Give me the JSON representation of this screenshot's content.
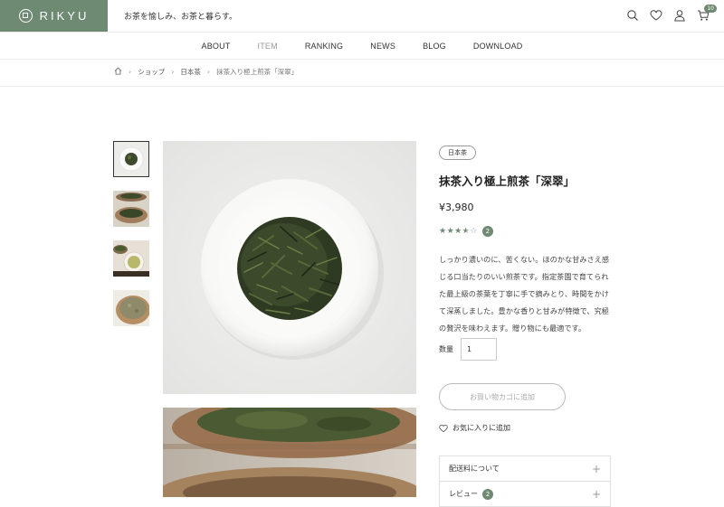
{
  "header": {
    "logo": "RIKYU",
    "tagline": "お茶を愉しみ、お茶と暮らす。",
    "icons": [
      "search-icon",
      "heart-icon",
      "user-icon",
      "cart-icon"
    ],
    "cart_count": "10"
  },
  "nav": {
    "items": [
      {
        "label": "ABOUT"
      },
      {
        "label": "ITEM"
      },
      {
        "label": "RANKING"
      },
      {
        "label": "NEWS"
      },
      {
        "label": "BLOG"
      },
      {
        "label": "DOWNLOAD"
      }
    ],
    "current": "ITEM"
  },
  "breadcrumb": {
    "items": [
      "ショップ",
      "日本茶"
    ],
    "current": "抹茶入り極上煎茶「深翠」"
  },
  "product": {
    "category": "日本茶",
    "title": "抹茶入り極上煎茶「深翠」",
    "price": "¥3,980",
    "rating": 3.5,
    "review_count": "2",
    "description": "しっかり濃いのに、苦くない。ほのかな甘みさえ感じる口当たりのいい煎茶です。指定茶園で育てられた最上級の茶葉を丁寧に手で摘みとり、時間をかけて深蒸しました。豊かな香りと甘みが特徴で、究極の贅沢を味わえます。贈り物にも最適です。",
    "quantity_label": "数量",
    "quantity": "1",
    "add_to_cart": "お買い物カゴに追加",
    "favorite": "お気に入りに追加"
  },
  "accordion": [
    {
      "label": "配送料について"
    },
    {
      "label": "レビュー",
      "badge": "2"
    }
  ],
  "colors": {
    "accent": "#6e8a73",
    "border": "#ececec"
  }
}
